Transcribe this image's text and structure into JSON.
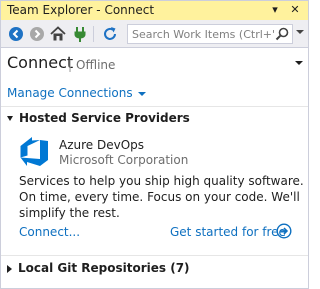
{
  "window": {
    "title": "Team Explorer - Connect",
    "dropdown_glyph": "▾",
    "close_glyph": "✕"
  },
  "toolbar": {
    "icons": [
      "back-icon",
      "forward-icon",
      "home-icon",
      "connect-plug-icon",
      "refresh-icon"
    ],
    "search_placeholder": "Search Work Items (Ctrl+')"
  },
  "header": {
    "title": "Connect",
    "status": "Offline"
  },
  "manage_connections": {
    "label": "Manage Connections"
  },
  "hosted_section": {
    "title": "Hosted Service Providers",
    "expanded": true,
    "provider": {
      "name": "Azure DevOps",
      "company": "Microsoft Corporation",
      "description": "Services to help you ship high quality software. On time, every time. Focus on your code. We'll simplify the rest.",
      "connect_label": "Connect...",
      "get_started_label": "Get started for free"
    }
  },
  "local_section": {
    "title": "Local Git Repositories (7)",
    "expanded": false
  },
  "colors": {
    "titlebar_bg": "#fff29d",
    "toolbar_bg": "#eeeef2",
    "link": "#0e70c0",
    "azure_blue": "#0078d4"
  }
}
